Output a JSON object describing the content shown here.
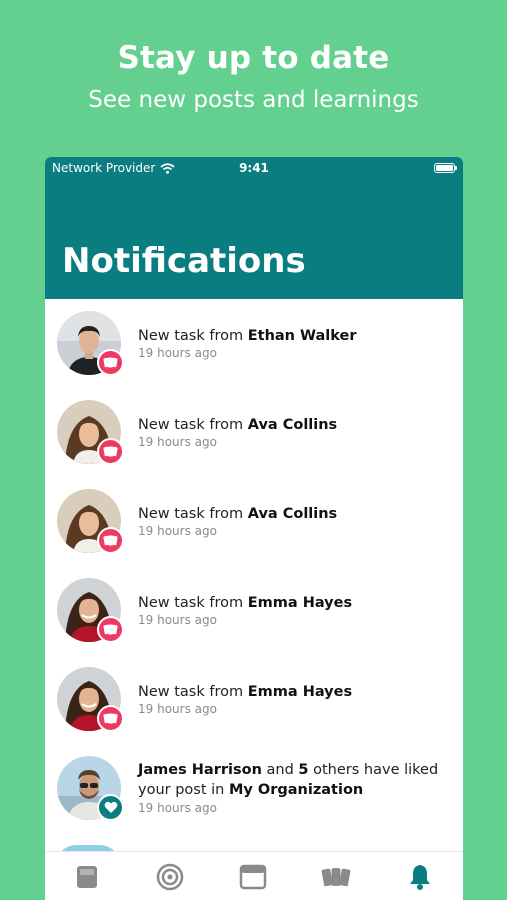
{
  "promo": {
    "headline": "Stay up to date",
    "subline": "See new posts and learnings"
  },
  "status_bar": {
    "carrier": "Network Provider",
    "time": "9:41"
  },
  "header": {
    "title": "Notifications"
  },
  "notifications": [
    {
      "prefix": "New task from ",
      "name": "Ethan Walker",
      "time": "19 hours ago",
      "badge": "task"
    },
    {
      "prefix": "New task from ",
      "name": "Ava Collins",
      "time": "19 hours ago",
      "badge": "task"
    },
    {
      "prefix": "New task from ",
      "name": "Ava Collins",
      "time": "19 hours ago",
      "badge": "task"
    },
    {
      "prefix": "New task from ",
      "name": "Emma Hayes",
      "time": "19 hours ago",
      "badge": "task"
    },
    {
      "prefix": "New task from ",
      "name": "Emma Hayes",
      "time": "19 hours ago",
      "badge": "task"
    }
  ],
  "like_notification": {
    "name": "James Harrison",
    "and": " and ",
    "count": "5",
    "others": " others have liked your post in ",
    "org": "My Organization",
    "time": "19 hours ago",
    "badge": "like"
  },
  "tabs": [
    {
      "icon": "home-icon"
    },
    {
      "icon": "target-icon"
    },
    {
      "icon": "browser-icon"
    },
    {
      "icon": "cards-icon"
    },
    {
      "icon": "bell-icon",
      "active": true
    }
  ],
  "colors": {
    "background": "#63d08f",
    "header": "#0a7d80",
    "task_badge": "#ee3963",
    "like_badge": "#0a7d80",
    "tab_inactive": "#8a8a8a",
    "tab_active": "#0a7d80"
  }
}
